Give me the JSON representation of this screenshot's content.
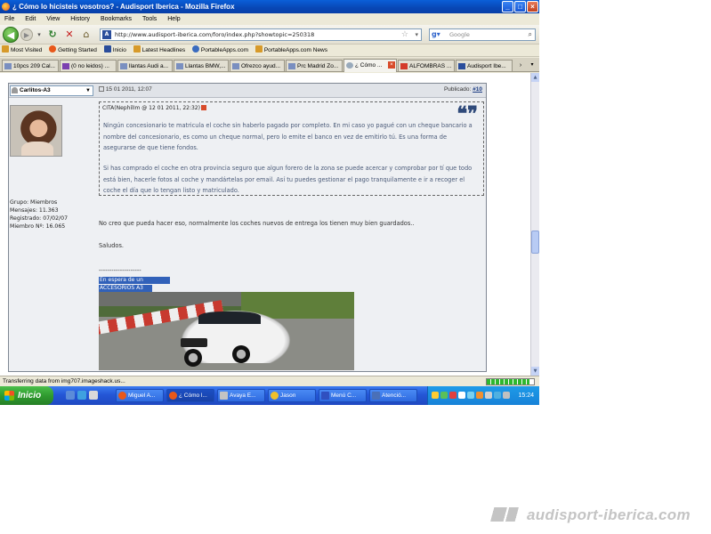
{
  "window": {
    "title": "¿ Cómo lo hicisteis vosotros? - Audisport Iberica - Mozilla Firefox",
    "buttons": [
      "minimize",
      "maximize",
      "close"
    ]
  },
  "menu": [
    "File",
    "Edit",
    "View",
    "History",
    "Bookmarks",
    "Tools",
    "Help"
  ],
  "navbar": {
    "url": "http://www.audisport-iberica.com/foro/index.php?showtopic=250318",
    "search_placeholder": "Google"
  },
  "bookmarks": [
    "Most Visited",
    "Getting Started",
    "Inicio",
    "Latest Headlines",
    "PortableApps.com",
    "PortableApps.com News"
  ],
  "tabs": [
    {
      "label": "10pcs 209 Cal...",
      "active": false
    },
    {
      "label": "(0 no leidos) ...",
      "active": false
    },
    {
      "label": "llantas Audi a...",
      "active": false
    },
    {
      "label": "Llantas BMW,...",
      "active": false
    },
    {
      "label": "Ofrezco ayud...",
      "active": false
    },
    {
      "label": "Prc Madrid Zo...",
      "active": false
    },
    {
      "label": "¿ Cómo ...",
      "active": true
    },
    {
      "label": "ALFOMBRAS ...",
      "active": false
    },
    {
      "label": "Audisport Ibe...",
      "active": false
    }
  ],
  "post": {
    "author": "Carlitos-A3",
    "date": "15 01 2011, 12:07",
    "published_label": "Publicado:",
    "post_number": "#10",
    "user_meta": {
      "group": "Grupo: Miembros",
      "messages": "Mensajes: 11.363",
      "registered": "Registrado: 07/02/07",
      "member_no": "Miembro Nº: 16.065"
    },
    "quote": {
      "header": "CITA(NephilIm @ 12 01 2011, 22:32)",
      "paragraph1": "Ningún concesionario te matricula el coche sin haberlo pagado por completo. En mi caso yo pagué con un cheque bancario a nombre del concesionario, es como un cheque normal, pero lo emite el banco en vez de emitirlo tú. Es una forma de asegurarse de que tiene fondos.",
      "paragraph2": "Si has comprado el coche en otra provincia seguro que algun forero de la zona se puede acercar y comprobar por tí que todo está bien, hacerle fotos al coche y mandártelas por email. Así tu puedes gestionar el pago tranquilamente e ir a recoger el coche el día que lo tengan listo y matriculado."
    },
    "reply": "No creo que pueda hacer eso, normalmente los coches nuevos de entrega los tienen muy bien guardados..",
    "regards": "Saludos.",
    "signature_separator": "--------------------",
    "signature_line1": "En espera de un Blanquito..",
    "signature_line2": "ACCESORIOS A3 S3"
  },
  "status": {
    "text": "Transferring data from img707.imageshack.us...",
    "progress": 0.9
  },
  "taskbar": {
    "start": "Inicio",
    "tasks": [
      {
        "label": "Miguel A...",
        "active": false
      },
      {
        "label": "¿ Cómo l...",
        "active": true
      },
      {
        "label": "Avaya E...",
        "active": false
      },
      {
        "label": "Jason",
        "active": false
      },
      {
        "label": "Menú C...",
        "active": false
      },
      {
        "label": "Atenció...",
        "active": false
      }
    ],
    "clock": "15:24"
  },
  "watermark": "audisport-iberica.com"
}
